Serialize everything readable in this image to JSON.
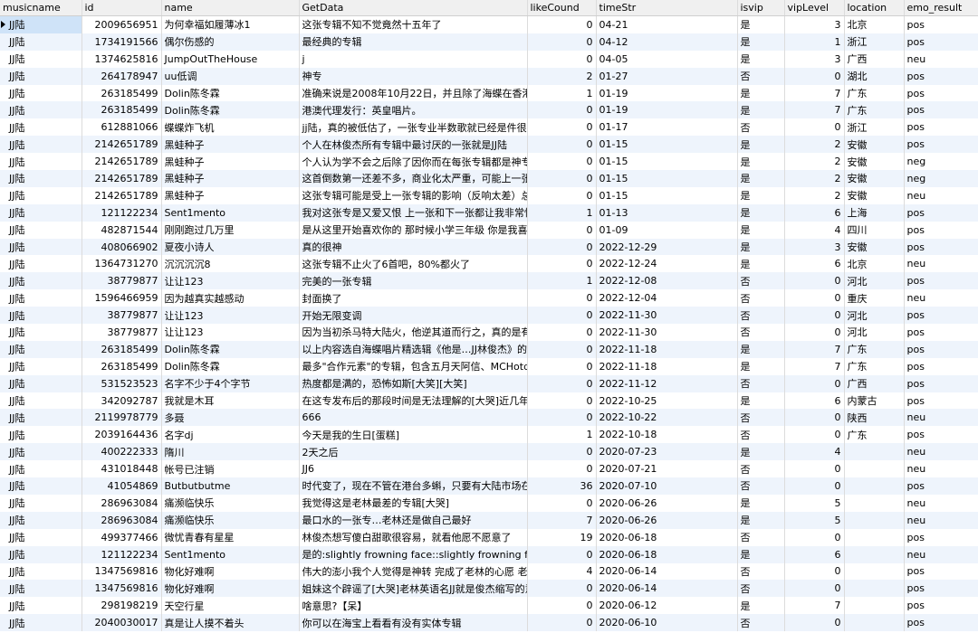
{
  "columns": [
    "musicname",
    "id",
    "name",
    "GetData",
    "likeCound",
    "timeStr",
    "isvip",
    "vipLevel",
    "location",
    "emo_result"
  ],
  "rows": [
    [
      "JJ陆",
      "2009656951",
      "为何幸福如履薄冰1",
      "这张专辑不知不觉竟然十五年了",
      "0",
      "04-21",
      "是",
      "3",
      "北京",
      "pos"
    ],
    [
      "JJ陆",
      "1734191566",
      "偶尔伤感的",
      "最经典的专辑",
      "0",
      "04-12",
      "是",
      "1",
      "浙江",
      "pos"
    ],
    [
      "JJ陆",
      "1374625816",
      "JumpOutTheHouse",
      "j",
      "0",
      "04-05",
      "是",
      "3",
      "广西",
      "neu"
    ],
    [
      "JJ陆",
      "264178947",
      "uu低调",
      "神专",
      "2",
      "01-27",
      "否",
      "0",
      "湖北",
      "pos"
    ],
    [
      "JJ陆",
      "263185499",
      "Dolin陈冬霖",
      "准确来说是2008年10月22日，并且除了海蝶在香港由豆",
      "1",
      "01-19",
      "是",
      "7",
      "广东",
      "pos"
    ],
    [
      "JJ陆",
      "263185499",
      "Dolin陈冬霖",
      "港澳代理发行：英皇唱片。",
      "0",
      "01-19",
      "是",
      "7",
      "广东",
      "pos"
    ],
    [
      "JJ陆",
      "612881066",
      "蝶蝶炸飞机",
      "jj陆，真的被低估了，一张专业半数歌就已经是件很牛谁",
      "0",
      "01-17",
      "否",
      "0",
      "浙江",
      "pos"
    ],
    [
      "JJ陆",
      "2142651789",
      "黑蛙种子",
      "个人在林俊杰所有专辑中最讨厌的一张就是JJ陆",
      "0",
      "01-15",
      "是",
      "2",
      "安徽",
      "pos"
    ],
    [
      "JJ陆",
      "2142651789",
      "黑蛙种子",
      "个人认为学不会之后除了因你而在每张专辑都是神专（",
      "0",
      "01-15",
      "是",
      "2",
      "安徽",
      "neg"
    ],
    [
      "JJ陆",
      "2142651789",
      "黑蛙种子",
      "这首倒数第一还差不多，商业化太严重，可能上一张专",
      "0",
      "01-15",
      "是",
      "2",
      "安徽",
      "neg"
    ],
    [
      "JJ陆",
      "2142651789",
      "黑蛙种子",
      "这张专辑可能是受上一张专辑的影响（反响太差）总觉",
      "0",
      "01-15",
      "是",
      "2",
      "安徽",
      "neu"
    ],
    [
      "JJ陆",
      "121122234",
      "Sent1mento",
      "我对这张专是又爱又恨 上一张和下一张都让我非常恨达",
      "1",
      "01-13",
      "是",
      "6",
      "上海",
      "pos"
    ],
    [
      "JJ陆",
      "482871544",
      "刚刚跑过几万里",
      "是从这里开始喜欢你的 那时候小学三年级 你是我喜欢的",
      "0",
      "01-09",
      "是",
      "4",
      "四川",
      "pos"
    ],
    [
      "JJ陆",
      "408066902",
      "夏夜小诗人",
      "真的很神",
      "0",
      "2022-12-29",
      "是",
      "3",
      "安徽",
      "pos"
    ],
    [
      "JJ陆",
      "1364731270",
      "沉沉沉沉8",
      "这张专辑不止火了6首吧，80%都火了",
      "0",
      "2022-12-24",
      "是",
      "6",
      "北京",
      "neu"
    ],
    [
      "JJ陆",
      "38779877",
      "让让123",
      "完美的一张专辑",
      "1",
      "2022-12-08",
      "否",
      "0",
      "河北",
      "pos"
    ],
    [
      "JJ陆",
      "1596466959",
      "因为越真实越感动",
      "封面换了",
      "0",
      "2022-12-04",
      "否",
      "0",
      "重庆",
      "neu"
    ],
    [
      "JJ陆",
      "38779877",
      "让让123",
      "开始无限变调",
      "0",
      "2022-11-30",
      "否",
      "0",
      "河北",
      "pos"
    ],
    [
      "JJ陆",
      "38779877",
      "让让123",
      "因为当初杀马特大陆火，他逆其道而行之，真的是有所",
      "0",
      "2022-11-30",
      "否",
      "0",
      "河北",
      "pos"
    ],
    [
      "JJ陆",
      "263185499",
      "Dolin陈冬霖",
      "以上内容选自海蝶唱片精选辑《他是…JJ林俊杰》的官方",
      "0",
      "2022-11-18",
      "是",
      "7",
      "广东",
      "pos"
    ],
    [
      "JJ陆",
      "263185499",
      "Dolin陈冬霖",
      "最多\"合作元素\"的专辑，包含五月天阿信、MCHotdog",
      "0",
      "2022-11-18",
      "是",
      "7",
      "广东",
      "pos"
    ],
    [
      "JJ陆",
      "531523523",
      "名字不少于4个字节",
      "热度都是满的，恐怖如斯[大笑][大笑]",
      "0",
      "2022-11-12",
      "否",
      "0",
      "广西",
      "pos"
    ],
    [
      "JJ陆",
      "342092787",
      "我就是木耳",
      "在这专发布后的那段时间是无法理解的[大哭]近几年才正",
      "0",
      "2022-10-25",
      "是",
      "6",
      "内蒙古",
      "pos"
    ],
    [
      "JJ陆",
      "2119978779",
      "多聂",
      "666",
      "0",
      "2022-10-22",
      "否",
      "0",
      "陕西",
      "neu"
    ],
    [
      "JJ陆",
      "2039164436",
      "名字dj",
      "今天是我的生日[蛋糕]",
      "1",
      "2022-10-18",
      "否",
      "0",
      "广东",
      "pos"
    ],
    [
      "JJ陆",
      "400222333",
      "隋川",
      "2天之后",
      "0",
      "2020-07-23",
      "是",
      "4",
      "",
      "neu"
    ],
    [
      "JJ陆",
      "431018448",
      "帐号已注销",
      "JJ6",
      "0",
      "2020-07-21",
      "否",
      "0",
      "",
      "neu"
    ],
    [
      "JJ陆",
      "41054869",
      "Butbutbutme",
      "时代变了，现在不管在港台多蝌，只要有大陆市场在，",
      "36",
      "2020-07-10",
      "否",
      "0",
      "",
      "pos"
    ],
    [
      "JJ陆",
      "286963084",
      "痛濒临快乐",
      "我觉得这是老林最差的专辑[大哭]",
      "0",
      "2020-06-26",
      "是",
      "5",
      "",
      "neu"
    ],
    [
      "JJ陆",
      "286963084",
      "痛濒临快乐",
      "最口水的一张专…老林还是做自己最好",
      "7",
      "2020-06-26",
      "是",
      "5",
      "",
      "neu"
    ],
    [
      "JJ陆",
      "499377466",
      "微忧青春有星星",
      "林俊杰想写傻白甜歌很容易，就看他愿不愿意了",
      "19",
      "2020-06-18",
      "否",
      "0",
      "",
      "pos"
    ],
    [
      "JJ陆",
      "121122234",
      "Sent1mento",
      "是的:slightly frowning face::slightly frowning face::s",
      "0",
      "2020-06-18",
      "是",
      "6",
      "",
      "neu"
    ],
    [
      "JJ陆",
      "1347569816",
      "物化好难啊",
      "伟大的澎小我个人觉得是神转 完成了老林的心愿 老林平",
      "4",
      "2020-06-14",
      "否",
      "0",
      "",
      "pos"
    ],
    [
      "JJ陆",
      "1347569816",
      "物化好难啊",
      "姐妹这个辟谣了[大哭]老林英语名JJ就是俊杰缩写的意思",
      "0",
      "2020-06-14",
      "否",
      "0",
      "",
      "pos"
    ],
    [
      "JJ陆",
      "298198219",
      "天空行星",
      "啥意思?【呆】",
      "0",
      "2020-06-12",
      "是",
      "7",
      "",
      "pos"
    ],
    [
      "JJ陆",
      "2040030017",
      "真是让人摸不着头",
      "你可以在海宝上看看有没有实体专辑",
      "0",
      "2020-06-10",
      "否",
      "0",
      "",
      "pos"
    ]
  ]
}
